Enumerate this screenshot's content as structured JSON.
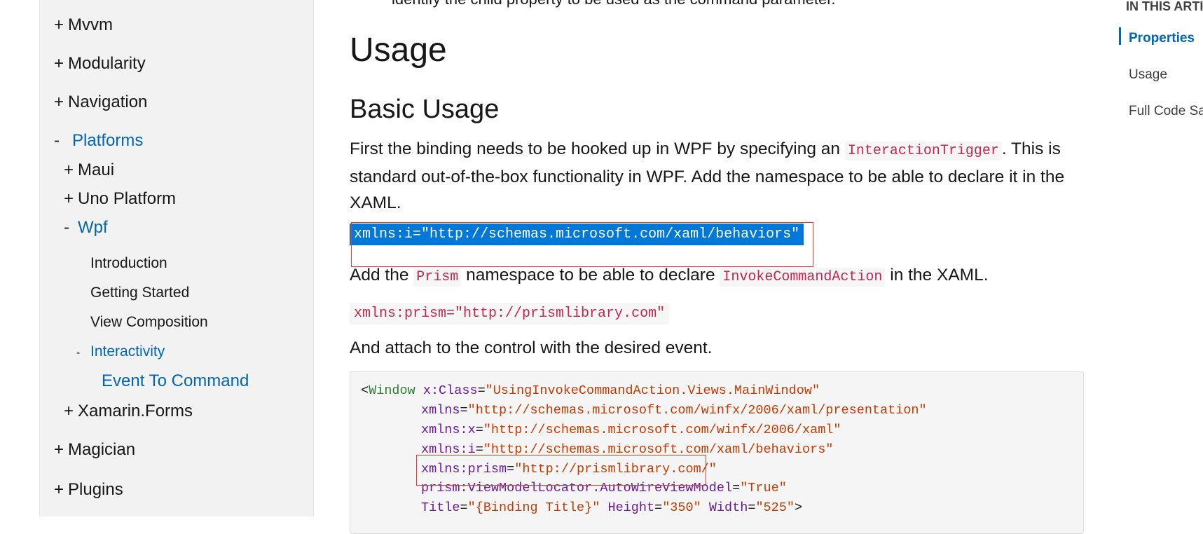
{
  "sidebar": {
    "items": [
      {
        "sign": "+",
        "label": "Mvvm"
      },
      {
        "sign": "+",
        "label": "Modularity"
      },
      {
        "sign": "+",
        "label": "Navigation"
      },
      {
        "sign": "-",
        "label": "Platforms"
      },
      {
        "sign": "+",
        "label": "Maui"
      },
      {
        "sign": "+",
        "label": "Uno Platform"
      },
      {
        "sign": "-",
        "label": "Wpf"
      },
      {
        "sign": "",
        "label": "Introduction"
      },
      {
        "sign": "",
        "label": "Getting Started"
      },
      {
        "sign": "",
        "label": "View Composition"
      },
      {
        "sign": "-",
        "label": "Interactivity"
      },
      {
        "sign": "",
        "label": "Event To Command"
      },
      {
        "sign": "+",
        "label": "Xamarin.Forms"
      },
      {
        "sign": "+",
        "label": "Magician"
      },
      {
        "sign": "+",
        "label": "Plugins"
      }
    ]
  },
  "main": {
    "intro_tail": "identify the child property to be used as the command parameter.",
    "h1": "Usage",
    "h2": "Basic Usage",
    "p1": {
      "a": "First the binding needs to be hooked up in WPF by specifying an ",
      "code": "InteractionTrigger",
      "b": ". This is standard out-of-the-box functionality in WPF. Add the namespace to be able to declare it in the XAML."
    },
    "code1": "xmlns:i=\"http://schemas.microsoft.com/xaml/behaviors\"",
    "p2": {
      "a": "Add the ",
      "code1": "Prism",
      "b": " namespace to be able to declare ",
      "code2": "InvokeCommandAction",
      "c": " in the XAML."
    },
    "code2": "xmlns:prism=\"http://prismlibrary.com\"",
    "p3": "And attach to the control with the desired event.",
    "codeblock": {
      "l1": {
        "lt": "<",
        "tag": "Window",
        "attr": "x:Class",
        "eq": "=",
        "val": "\"UsingInvokeCommandAction.Views.MainWindow\""
      },
      "l2": {
        "attr": "xmlns",
        "eq": "=",
        "val": "\"http://schemas.microsoft.com/winfx/2006/xaml/presentation\""
      },
      "l3": {
        "attr": "xmlns:x",
        "eq": "=",
        "val": "\"http://schemas.microsoft.com/winfx/2006/xaml\""
      },
      "l4": {
        "attr": "xmlns:i",
        "eq": "=",
        "val": "\"http://schemas.microsoft.com/xaml/behaviors\""
      },
      "l5": {
        "attr": "xmlns:prism",
        "eq": "=",
        "val": "\"http://prismlibrary.com/\""
      },
      "l6": {
        "attr": "prism:ViewModelLocator.AutoWireViewModel",
        "eq": "=",
        "val": "\"True\""
      },
      "l7": {
        "attr1": "Title",
        "eq1": "=",
        "val1": "\"{Binding Title}\"",
        "attr2": "Height",
        "eq2": "=",
        "val2": "\"350\"",
        "attr3": "Width",
        "eq3": "=",
        "val3": "\"525\"",
        "gt": ">"
      }
    }
  },
  "toc": {
    "title": "IN THIS ARTICLE",
    "items": [
      "Properties",
      "Usage",
      "Full Code Sample"
    ]
  }
}
